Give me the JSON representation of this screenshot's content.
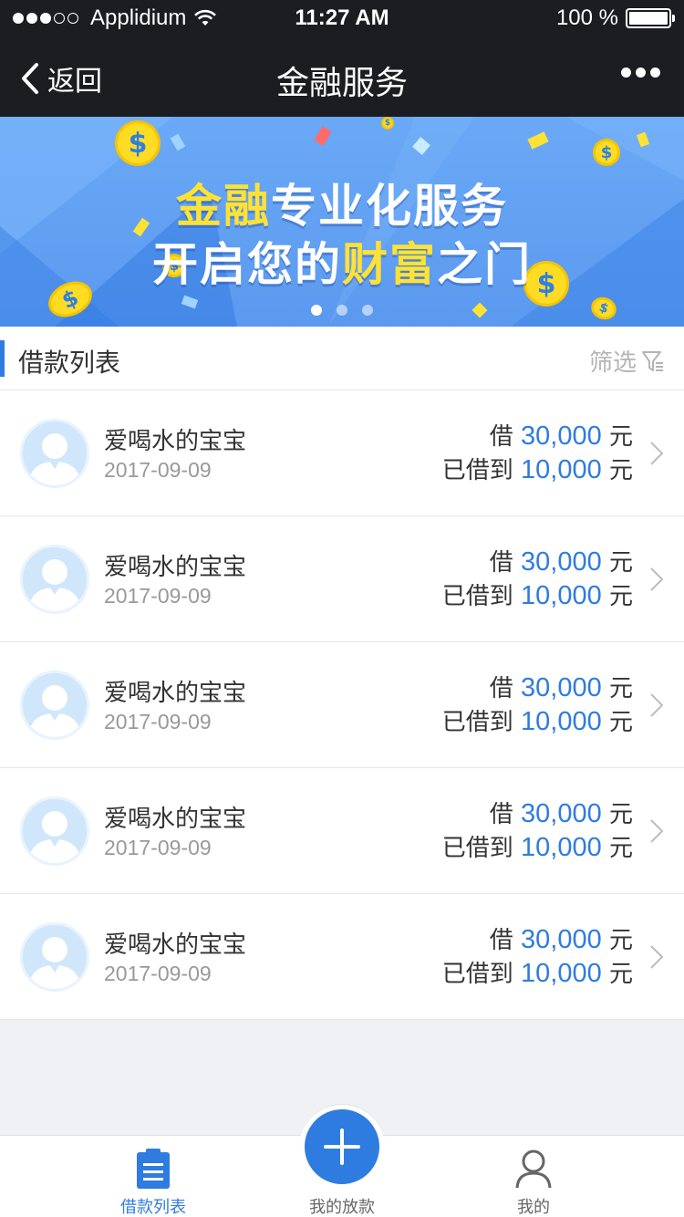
{
  "status_bar": {
    "carrier": "Applidium",
    "time": "11:27 AM",
    "battery": "100 %",
    "signal_bars_filled": 3,
    "signal_bars_total": 5
  },
  "nav": {
    "back_label": "返回",
    "title": "金融服务",
    "more_icon": "more-dots-icon"
  },
  "banner": {
    "line1_highlight": "金融",
    "line1_rest": "专业化服务",
    "line2_start": "开启您的",
    "line2_highlight": "财富",
    "line2_end": "之门",
    "pages": 3,
    "active_page": 1,
    "colors": {
      "background": "#5b99ef",
      "highlight": "#ffe234",
      "coin": "#ffdc24"
    }
  },
  "section": {
    "title": "借款列表",
    "filter_label": "筛选",
    "filter_icon": "filter-funnel-icon"
  },
  "loans": [
    {
      "name": "爱喝水的宝宝",
      "date": "2017-09-09",
      "borrow_prefix": "借",
      "borrow_amount": "30,000",
      "borrow_unit": "元",
      "received_prefix": "已借到",
      "received_amount": "10,000",
      "received_unit": "元"
    },
    {
      "name": "爱喝水的宝宝",
      "date": "2017-09-09",
      "borrow_prefix": "借",
      "borrow_amount": "30,000",
      "borrow_unit": "元",
      "received_prefix": "已借到",
      "received_amount": "10,000",
      "received_unit": "元"
    },
    {
      "name": "爱喝水的宝宝",
      "date": "2017-09-09",
      "borrow_prefix": "借",
      "borrow_amount": "30,000",
      "borrow_unit": "元",
      "received_prefix": "已借到",
      "received_amount": "10,000",
      "received_unit": "元"
    },
    {
      "name": "爱喝水的宝宝",
      "date": "2017-09-09",
      "borrow_prefix": "借",
      "borrow_amount": "30,000",
      "borrow_unit": "元",
      "received_prefix": "已借到",
      "received_amount": "10,000",
      "received_unit": "元"
    },
    {
      "name": "爱喝水的宝宝",
      "date": "2017-09-09",
      "borrow_prefix": "借",
      "borrow_amount": "30,000",
      "borrow_unit": "元",
      "received_prefix": "已借到",
      "received_amount": "10,000",
      "received_unit": "元"
    }
  ],
  "tabs": [
    {
      "label": "借款列表",
      "icon": "clipboard-list-icon",
      "active": true
    },
    {
      "label": "我的放款",
      "icon": "plus-icon",
      "active": false
    },
    {
      "label": "我的",
      "icon": "user-icon",
      "active": false
    }
  ],
  "colors": {
    "accent": "#2f7ce0",
    "nav_bg": "#1c1d21",
    "page_bg": "#eff1f4"
  }
}
